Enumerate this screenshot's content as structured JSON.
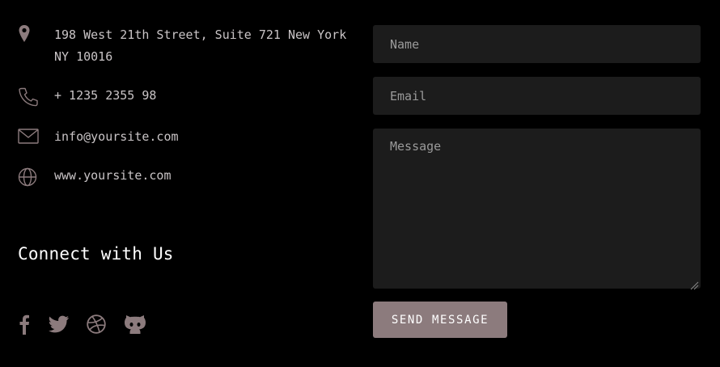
{
  "contact": {
    "address": "198 West 21th Street, Suite 721 New York NY 10016",
    "phone": "+ 1235 2355 98",
    "email": "info@yoursite.com",
    "website": "www.yoursite.com",
    "icons": [
      "map-pin-icon",
      "phone-icon",
      "mail-icon",
      "globe-icon"
    ]
  },
  "connect": {
    "title": "Connect with Us",
    "social_icons": [
      "facebook-icon",
      "twitter-icon",
      "dribbble-icon",
      "github-icon"
    ]
  },
  "form": {
    "name_placeholder": "Name",
    "email_placeholder": "Email",
    "message_placeholder": "Message",
    "submit_label": "SEND MESSAGE"
  },
  "colors": {
    "background": "#000000",
    "accent": "#8c7b7d",
    "field_bg": "#1c1c1c",
    "icon": "#8c7b7d",
    "text": "#c9c4c6"
  }
}
